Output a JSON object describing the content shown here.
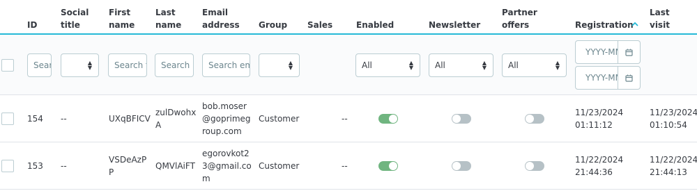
{
  "columns": {
    "id": "ID",
    "social_title": "Social\ntitle",
    "first_name": "First\nname",
    "last_name": "Last\nname",
    "email": "Email\naddress",
    "group": "Group",
    "sales": "Sales",
    "enabled": "Enabled",
    "newsletter": "Newsletter",
    "partner_offers": "Partner\noffers",
    "registration": "Registration",
    "last_visit": "Last\nvisit"
  },
  "filters": {
    "id_placeholder": "Search ID",
    "first_name_placeholder": "Search first name",
    "last_name_placeholder": "Search last name",
    "email_placeholder": "Search email",
    "enabled_value": "All",
    "newsletter_value": "All",
    "partner_offers_value": "All",
    "date_from_placeholder": "YYYY-MM-DD",
    "date_to_placeholder": "YYYY-MM-DD"
  },
  "rows": [
    {
      "id": "154",
      "social_title": "--",
      "first_name": "UXqBFICV",
      "last_name": "zulDwohx\nA",
      "email": "bob.moser\n@goprimeg\nroup.com",
      "group": "Customer",
      "sales": "--",
      "enabled": true,
      "newsletter": false,
      "partner_offers": false,
      "registration": "11/23/2024\n01:11:12",
      "last_visit": "11/23/2024\n01:10:54"
    },
    {
      "id": "153",
      "social_title": "--",
      "first_name": "VSDeAzP\nP",
      "last_name": "QMVlAiFT",
      "email": "egorovkot2\n3@gmail.co\nm",
      "group": "Customer",
      "sales": "--",
      "enabled": true,
      "newsletter": false,
      "partner_offers": false,
      "registration": "11/22/2024\n21:44:36",
      "last_visit": "11/22/2024\n21:44:13"
    }
  ],
  "colors": {
    "accent": "#25b9d7",
    "toggle_on": "#70b580",
    "toggle_off": "#b6c1c6"
  }
}
